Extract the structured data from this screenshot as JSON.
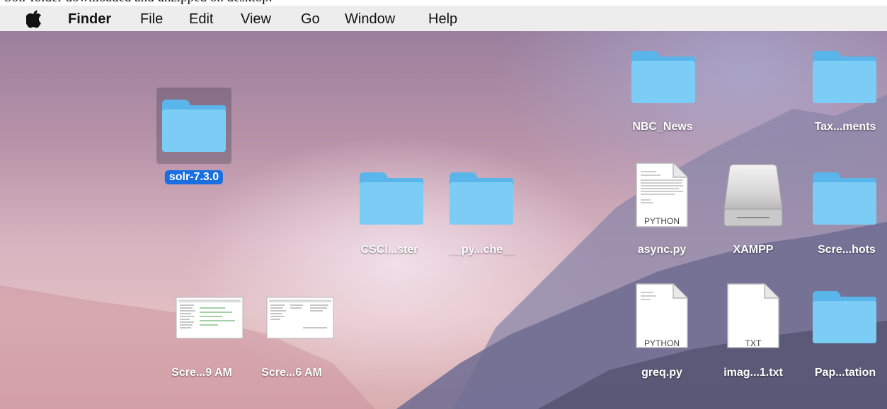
{
  "caption": "Solr folder downloaded and unzipped on desktop.",
  "menubar": {
    "apple_icon": "apple-icon",
    "items": [
      "Finder",
      "File",
      "Edit",
      "View",
      "Go",
      "Window",
      "Help"
    ]
  },
  "colors": {
    "folder": "#7ccdf6",
    "selection": "#1a6fe0",
    "menubar": "#ededed"
  },
  "desktop_icons": {
    "solr": "solr-7.3.0",
    "nbc_news": "NBC_News",
    "taxments": "Tax...ments",
    "csci": "CSCI...ster",
    "pycache": "__py...che__",
    "async": "async.py",
    "async_badge": "PYTHON",
    "xampp": "XAMPP",
    "screhots": "Scre...hots",
    "scre9am": "Scre...9 AM",
    "scre6am": "Scre...6 AM",
    "greq": "greq.py",
    "greq_badge": "PYTHON",
    "imag": "imag...1.txt",
    "imag_badge": "TXT",
    "paptation": "Pap...tation"
  }
}
